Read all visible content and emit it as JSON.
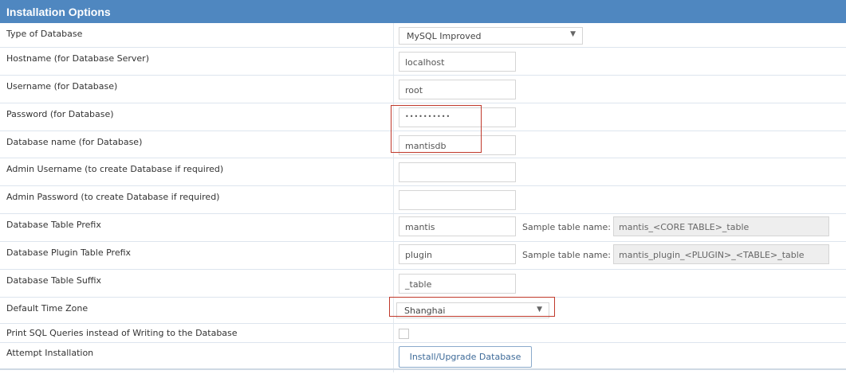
{
  "panel": {
    "title": "Installation Options"
  },
  "rows": {
    "db_type": {
      "label": "Type of Database",
      "value": "MySQL Improved"
    },
    "hostname": {
      "label": "Hostname (for Database Server)",
      "value": "localhost"
    },
    "username": {
      "label": "Username (for Database)",
      "value": "root"
    },
    "password": {
      "label": "Password (for Database)",
      "value": "••••••••••"
    },
    "db_name": {
      "label": "Database name (for Database)",
      "value": "mantisdb"
    },
    "admin_username": {
      "label": "Admin Username (to create Database if required)",
      "value": ""
    },
    "admin_password": {
      "label": "Admin Password (to create Database if required)",
      "value": ""
    },
    "table_prefix": {
      "label": "Database Table Prefix",
      "value": "mantis",
      "sample_label": "Sample table name:",
      "sample_value": "mantis_<CORE TABLE>_table"
    },
    "plugin_prefix": {
      "label": "Database Plugin Table Prefix",
      "value": "plugin",
      "sample_label": "Sample table name:",
      "sample_value": "mantis_plugin_<PLUGIN>_<TABLE>_table"
    },
    "table_suffix": {
      "label": "Database Table Suffix",
      "value": "_table"
    },
    "timezone": {
      "label": "Default Time Zone",
      "value": "Shanghai"
    },
    "print_sql": {
      "label": "Print SQL Queries instead of Writing to the Database",
      "checked": false
    },
    "install": {
      "label": "Attempt Installation",
      "button": "Install/Upgrade Database"
    }
  },
  "icons": {
    "dropdown": "chevron-down-icon"
  },
  "colors": {
    "header": "#4f87c0",
    "highlight": "#c0392b",
    "button_text": "#3d6a98"
  }
}
